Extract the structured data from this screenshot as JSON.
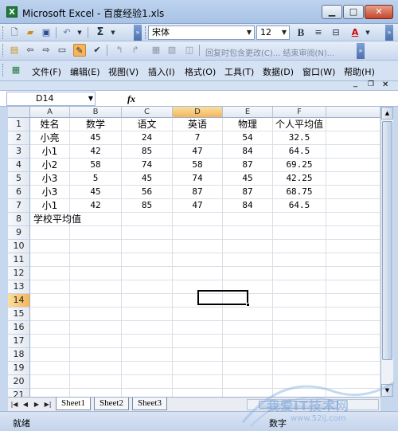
{
  "window": {
    "title": "Microsoft Excel - 百度经验1.xls",
    "app_icon": "X"
  },
  "toolbar": {
    "font_name": "宋体",
    "font_size": "12",
    "bold_label": "B",
    "font_color_label": "A",
    "sum_label": "Σ",
    "review_text": "回复时包含更改(C)... 结束审阅(N)..."
  },
  "menu": {
    "items": [
      "文件(F)",
      "编辑(E)",
      "视图(V)",
      "插入(I)",
      "格式(O)",
      "工具(T)",
      "数据(D)",
      "窗口(W)",
      "帮助(H)"
    ]
  },
  "formula_bar": {
    "name_box": "D14",
    "fx_label": "fx",
    "content": ""
  },
  "grid": {
    "columns": [
      "A",
      "B",
      "C",
      "D",
      "E",
      "F"
    ],
    "selected_column": "D",
    "selected_row": "14",
    "rows": [
      "1",
      "2",
      "3",
      "4",
      "5",
      "6",
      "7",
      "8",
      "9",
      "10",
      "11",
      "12",
      "13",
      "14",
      "15",
      "16",
      "17",
      "18",
      "19",
      "20",
      "21"
    ],
    "data": [
      [
        "姓名",
        "数学",
        "语文",
        "英语",
        "物理",
        "个人平均值"
      ],
      [
        "小亮",
        "45",
        "24",
        "7",
        "54",
        "32.5"
      ],
      [
        "小1",
        "42",
        "85",
        "47",
        "84",
        "64.5"
      ],
      [
        "小2",
        "58",
        "74",
        "58",
        "87",
        "69.25"
      ],
      [
        "小3",
        "5",
        "45",
        "74",
        "45",
        "42.25"
      ],
      [
        "小3",
        "45",
        "56",
        "87",
        "87",
        "68.75"
      ],
      [
        "小1",
        "42",
        "85",
        "47",
        "84",
        "64.5"
      ],
      [
        "学校平均值",
        "",
        "",
        "",
        "",
        ""
      ]
    ]
  },
  "sheets": {
    "tabs": [
      "Sheet1",
      "Sheet2",
      "Sheet3"
    ],
    "active": "Sheet1"
  },
  "status": {
    "ready": "就绪",
    "num": "数字"
  },
  "watermark": {
    "text": "我爱IT技术网",
    "url": "www.52ij.com"
  },
  "colors": {
    "selected_header": "#f5b55a",
    "accent": "#4d70ad"
  }
}
